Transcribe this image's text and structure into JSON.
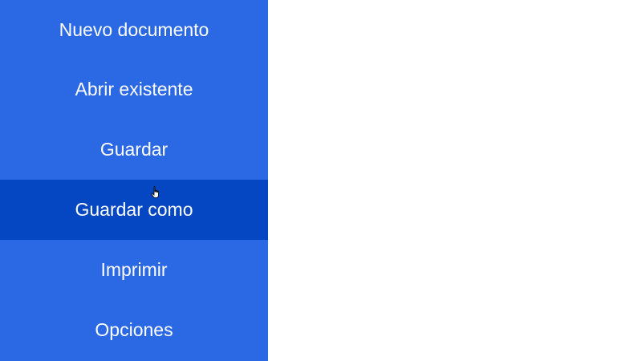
{
  "menu": {
    "items": [
      {
        "label": "Nuevo documento"
      },
      {
        "label": "Abrir existente"
      },
      {
        "label": "Guardar"
      },
      {
        "label": "Guardar como",
        "active": true
      },
      {
        "label": "Imprimir"
      },
      {
        "label": "Opciones"
      }
    ]
  },
  "colors": {
    "menu_bg": "#2b68e4",
    "menu_active_bg": "#0547c2",
    "text": "#ffffff",
    "content_bg": "#ffffff"
  },
  "icons": {
    "cursor": "hand-pointer-icon"
  }
}
